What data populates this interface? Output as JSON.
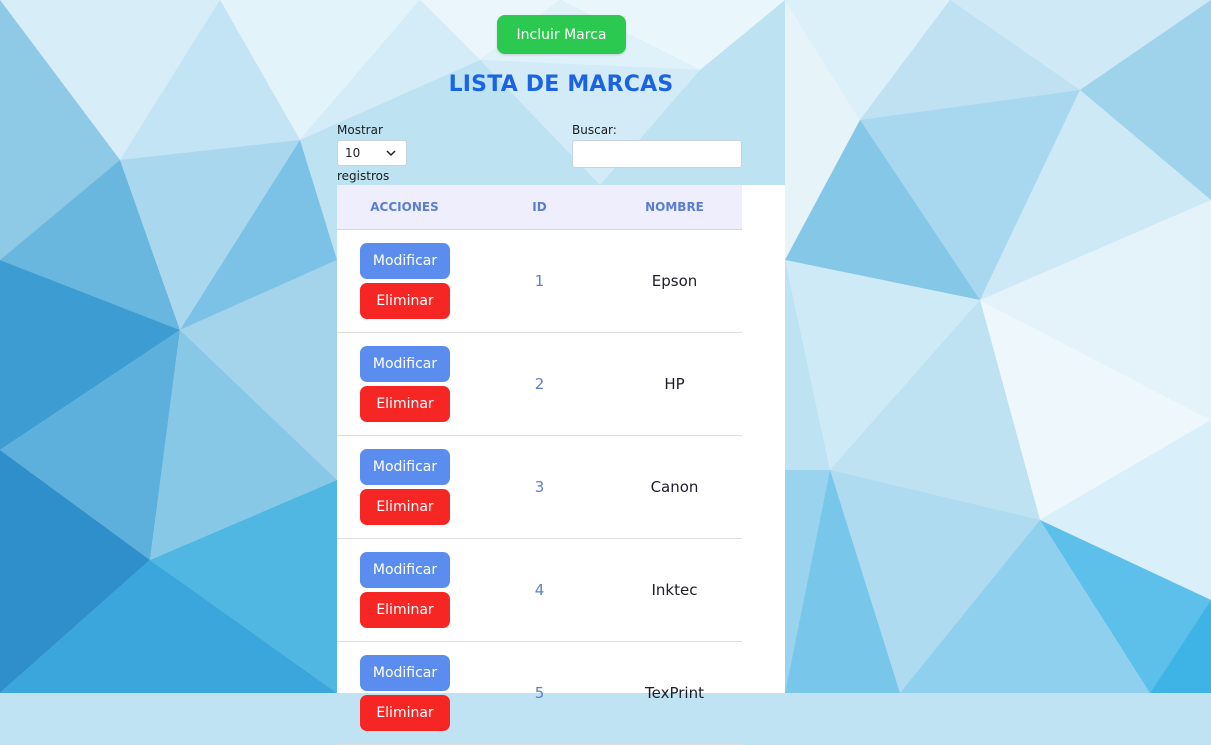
{
  "header": {
    "add_button_label": "Incluir Marca",
    "title": "LISTA DE MARCAS"
  },
  "controls": {
    "show_label": "Mostrar",
    "page_size_value": "10",
    "records_label": "registros",
    "search_label": "Buscar:",
    "search_value": ""
  },
  "table": {
    "columns": [
      "ACCIONES",
      "ID",
      "NOMBRE"
    ],
    "modify_label": "Modificar",
    "delete_label": "Eliminar",
    "rows": [
      {
        "id": "1",
        "nombre": "Epson"
      },
      {
        "id": "2",
        "nombre": "HP"
      },
      {
        "id": "3",
        "nombre": "Canon"
      },
      {
        "id": "4",
        "nombre": "Inktec"
      },
      {
        "id": "5",
        "nombre": "TexPrint"
      }
    ]
  },
  "colors": {
    "add_button": "#2bc94f",
    "title": "#1a63e3",
    "modify_button": "#5b8def",
    "delete_button": "#f62625",
    "header_bg": "#efeefc",
    "header_text": "#5a7fcf"
  },
  "icons": {
    "select_arrow": "chevron-down-icon"
  }
}
